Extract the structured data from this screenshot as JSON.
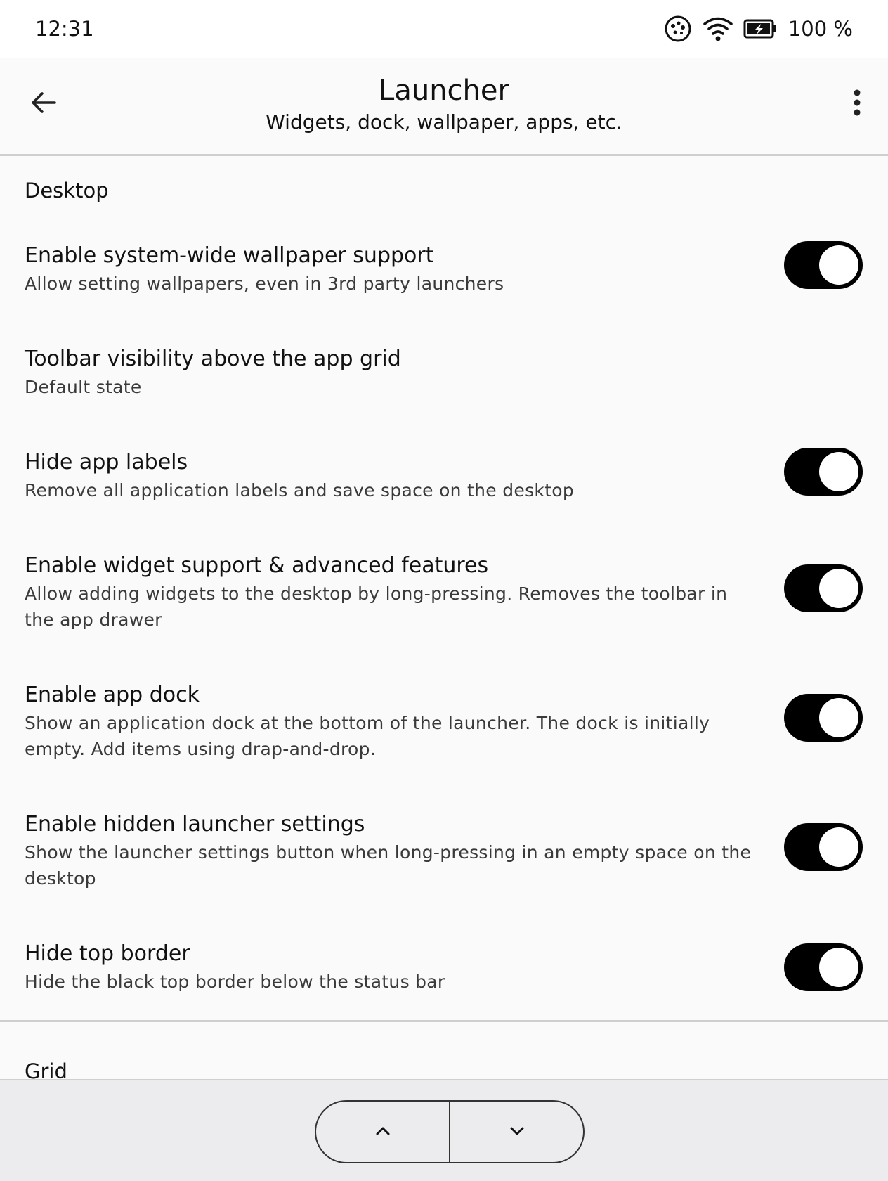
{
  "status": {
    "time": "12:31",
    "battery_text": "100 %",
    "icons": [
      "sync-icon",
      "wifi-icon",
      "battery-charging-icon"
    ]
  },
  "appbar": {
    "title": "Launcher",
    "subtitle": "Widgets, dock, wallpaper, apps, etc.",
    "back_icon": "arrow-back-icon",
    "menu_icon": "more-vert-icon"
  },
  "sections": {
    "desktop": "Desktop",
    "grid": "Grid"
  },
  "settings": [
    {
      "title": "Enable system-wide wallpaper support",
      "desc": "Allow setting wallpapers, even in 3rd party launchers",
      "toggle": true
    },
    {
      "title": "Toolbar visibility above the app grid",
      "desc": "Default state",
      "toggle": null
    },
    {
      "title": "Hide app labels",
      "desc": "Remove all application labels and save space on the desktop",
      "toggle": true
    },
    {
      "title": "Enable widget support & advanced features",
      "desc": "Allow adding widgets to the desktop by long-pressing. Removes the toolbar in the app drawer",
      "toggle": true
    },
    {
      "title": "Enable app dock",
      "desc": "Show an application dock at the bottom of the launcher. The dock is initially empty. Add items using drap-and-drop.",
      "toggle": true
    },
    {
      "title": "Enable hidden launcher settings",
      "desc": "Show the launcher settings button when long-pressing in an empty space on the desktop",
      "toggle": true
    },
    {
      "title": "Hide top border",
      "desc": "Hide the black top border below the status bar",
      "toggle": true
    }
  ],
  "pager": {
    "up_icon": "chevron-up-icon",
    "down_icon": "chevron-down-icon"
  }
}
